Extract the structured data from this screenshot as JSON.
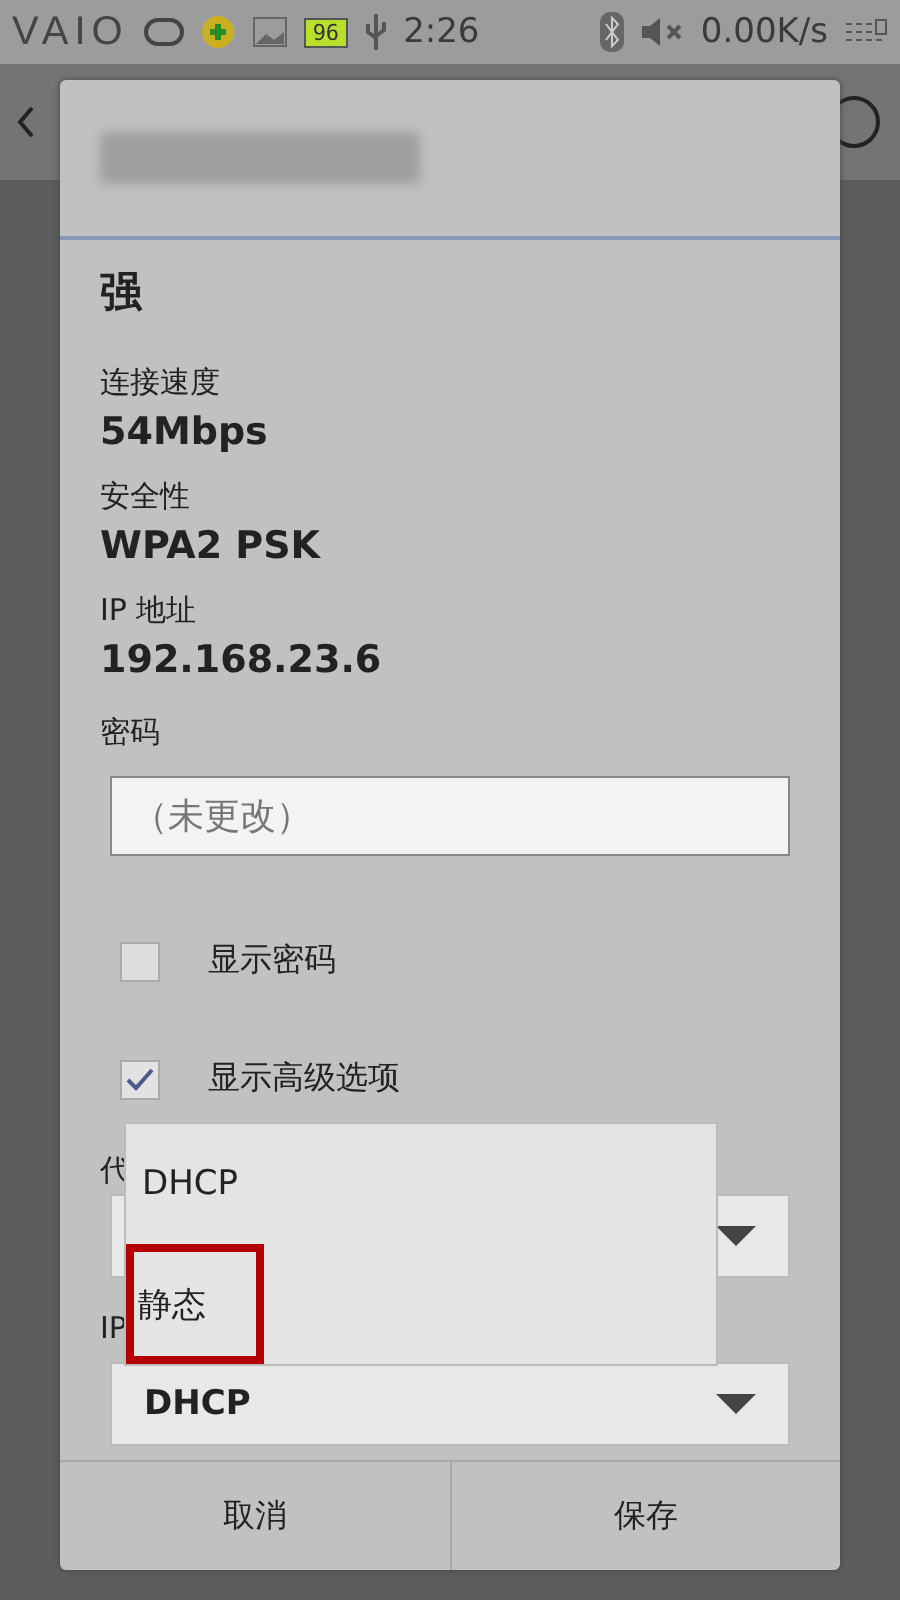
{
  "status_bar": {
    "logo": "VAIO",
    "battery": "96",
    "time": "2:26",
    "net_speed": "0.00K/s"
  },
  "dialog": {
    "signal_value": "强",
    "fields": [
      {
        "label": "连接速度",
        "value": "54Mbps"
      },
      {
        "label": "安全性",
        "value": "WPA2 PSK"
      },
      {
        "label": "IP 地址",
        "value": "192.168.23.6"
      }
    ],
    "password": {
      "label": "密码",
      "placeholder": "（未更改）"
    },
    "checkboxes": [
      {
        "label": "显示密码",
        "checked": false
      },
      {
        "label": "显示高级选项",
        "checked": true
      }
    ],
    "proxy": {
      "label": "代"
    },
    "ip_settings": {
      "label": "IP",
      "value": "DHCP"
    },
    "buttons": [
      "取消",
      "保存"
    ]
  },
  "dropdown": {
    "options": [
      {
        "label": "DHCP",
        "selected": false
      },
      {
        "label": "静态",
        "selected": true
      }
    ]
  }
}
